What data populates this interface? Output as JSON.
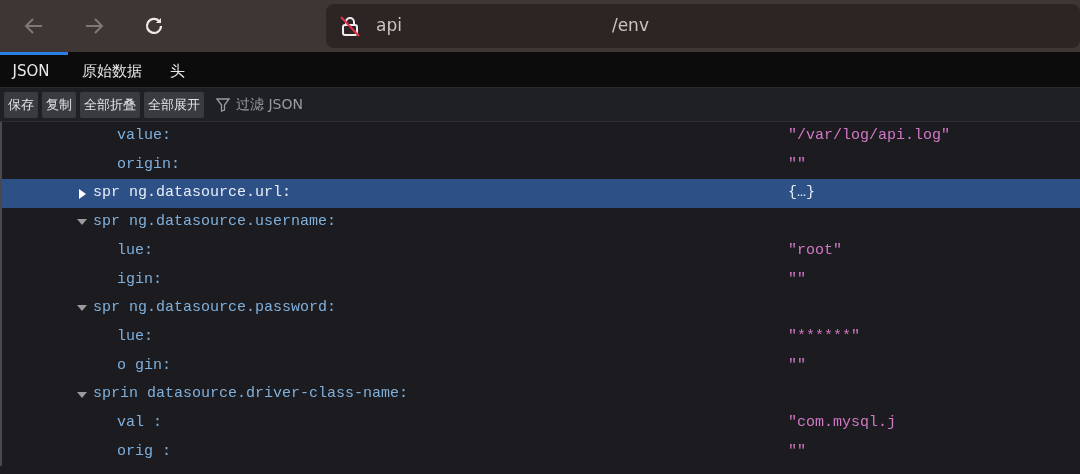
{
  "browser": {
    "back_disabled": true,
    "forward_disabled": true,
    "url_start": "api",
    "url_end": "/env",
    "insecure": true
  },
  "tabs": [
    {
      "label": "JSON",
      "selected": true
    },
    {
      "label": "原始数据",
      "selected": false
    },
    {
      "label": "头",
      "selected": false
    }
  ],
  "toolbar": {
    "buttons": [
      "保存",
      "复制",
      "全部折叠",
      "全部展开"
    ],
    "filter_placeholder": "过滤 JSON"
  },
  "rows": [
    {
      "children": [
        {
          "key": "value:",
          "value": "\"/var/log/api.log\"",
          "selected": false
        },
        {
          "key": "origin:",
          "value": "\"\"",
          "selected": false
        }
      ]
    },
    {
      "key": "spr ng.datasource.url:",
      "value": "{…}",
      "expanded": false,
      "selected": true
    },
    {
      "key": "spr ng.datasource.username:",
      "expanded": true,
      "selected": false,
      "children": [
        {
          "key": "lue:",
          "value": "\"root\"",
          "selected": false
        },
        {
          "key": "igin:",
          "value": "\"\"",
          "selected": false
        }
      ]
    },
    {
      "key": "spr ng.datasource.password:",
      "expanded": true,
      "selected": false,
      "children": [
        {
          "key": "lue:",
          "value": "\"******\"",
          "selected": false
        },
        {
          "key": "o gin:",
          "value": "\"\"",
          "selected": false
        }
      ]
    },
    {
      "key": "sprin datasource.driver-class-name:",
      "expanded": true,
      "selected": false,
      "children": [
        {
          "key": "val :",
          "value": "\"com.mysql.j",
          "selected": false
        },
        {
          "key": "orig :",
          "value": "\"\"",
          "selected": false
        }
      ]
    }
  ]
}
